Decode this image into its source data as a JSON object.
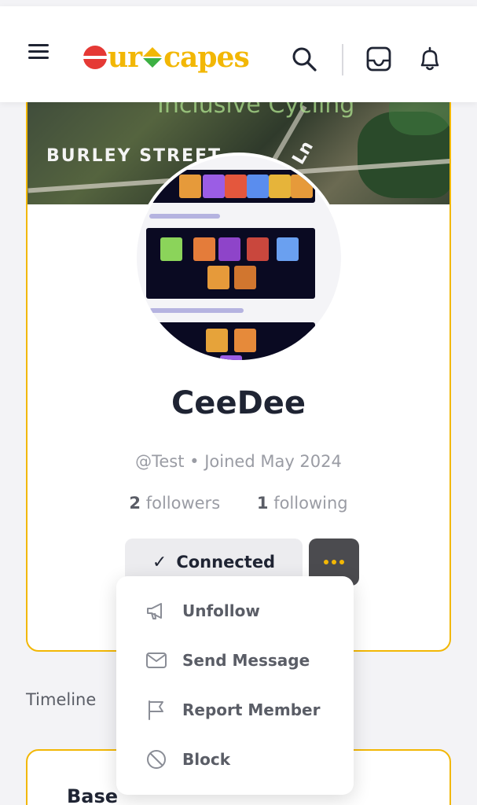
{
  "header": {
    "logo_text_left": "ur",
    "logo_text_right": "capes",
    "brand_colors": {
      "yellow": "#f2b705",
      "red": "#e53935",
      "green": "#3cb043"
    }
  },
  "cover": {
    "street_label": "BURLEY STREET",
    "road_label": "Ln",
    "faded_label": "Inclusive Cycling"
  },
  "profile": {
    "name": "CeeDee",
    "meta": "@Test • Joined May 2024",
    "followers_count": "2",
    "followers_label": "followers",
    "following_count": "1",
    "following_label": "following",
    "connected_label": "Connected"
  },
  "menu": {
    "items": [
      {
        "label": "Unfollow",
        "icon": "megaphone-icon"
      },
      {
        "label": "Send Message",
        "icon": "envelope-icon"
      },
      {
        "label": "Report Member",
        "icon": "flag-icon"
      },
      {
        "label": "Block",
        "icon": "block-icon"
      }
    ]
  },
  "timeline": {
    "label": "Timeline",
    "first_post_title": "Base"
  }
}
